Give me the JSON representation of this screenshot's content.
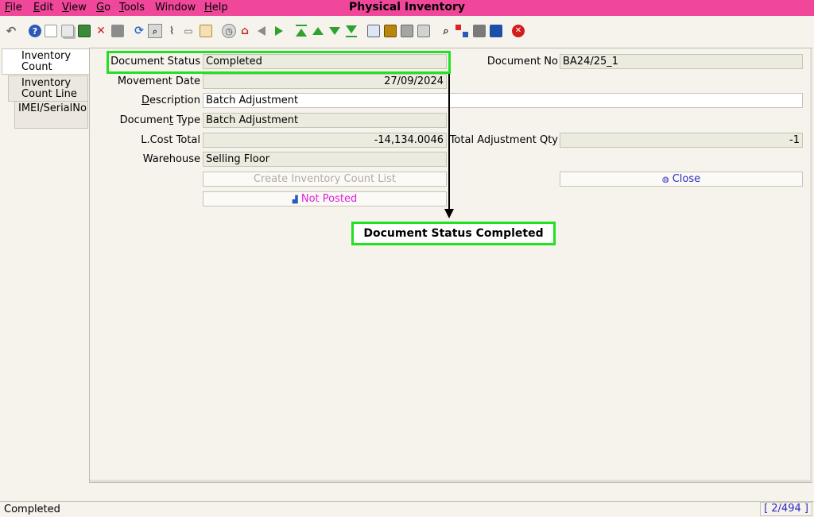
{
  "window": {
    "title": "Physical Inventory",
    "menu": [
      {
        "accel": "F",
        "rest": "ile"
      },
      {
        "accel": "E",
        "rest": "dit"
      },
      {
        "accel": "V",
        "rest": "iew"
      },
      {
        "accel": "G",
        "rest": "o"
      },
      {
        "accel": "T",
        "rest": "ools"
      },
      {
        "accel": "",
        "rest": "Window"
      },
      {
        "accel": "H",
        "rest": "elp"
      }
    ]
  },
  "toolbar": {
    "icons": [
      "undo-icon",
      "help-icon",
      "new-record-icon",
      "copy-record-icon",
      "save-icon",
      "delete-icon",
      "print-preview-icon",
      "refresh-icon",
      "find-icon",
      "attachment-icon",
      "chat-icon",
      "history-icon",
      "lookup-icon",
      "home-icon",
      "previous-record-icon",
      "next-record-icon",
      "first-record-icon",
      "parent-record-icon",
      "detail-record-icon",
      "last-record-icon",
      "report-icon",
      "archive-icon",
      "print-icon",
      "print-setup-icon",
      "zoom-across-icon",
      "workflow-icon",
      "product-info-icon",
      "end-icon",
      "exit-icon"
    ]
  },
  "tabs": [
    {
      "line1": "Inventory",
      "line2": "Count"
    },
    {
      "line1": "Inventory",
      "line2": "Count Line"
    },
    {
      "line1": "IMEI/SerialNo",
      "line2": ""
    }
  ],
  "form": {
    "document_status_label": "Document Status",
    "document_status_value": "Completed",
    "document_no_label": "Document No",
    "document_no_value": "BA24/25_1",
    "movement_date_label": "Movement Date",
    "movement_date_value": "27/09/2024",
    "description_label_accel": "D",
    "description_label_rest": "escription",
    "description_value": "Batch Adjustment",
    "document_type_label_pre": "Documen",
    "document_type_label_accel": "t",
    "document_type_label_post": " Type",
    "document_type_value": "Batch Adjustment",
    "lcost_total_label": "L.Cost Total",
    "lcost_total_value": "-14,134.0046",
    "total_adjustment_qty_label": "Total Adjustment Qty",
    "total_adjustment_qty_value": "-1",
    "warehouse_label": "Warehouse",
    "warehouse_value": "Selling Floor",
    "create_count_list_label": "Create Inventory Count List",
    "close_label": "Close",
    "not_posted_label": "Not Posted"
  },
  "annotation": {
    "callout_text": "Document Status Completed",
    "color": "#22e022"
  },
  "status": {
    "text": "Completed",
    "record_count": "[ 2/494 ]"
  },
  "colors": {
    "title_bar": "#f0479b",
    "not_posted": "#e020e0",
    "close_text": "#2a2ac0"
  }
}
